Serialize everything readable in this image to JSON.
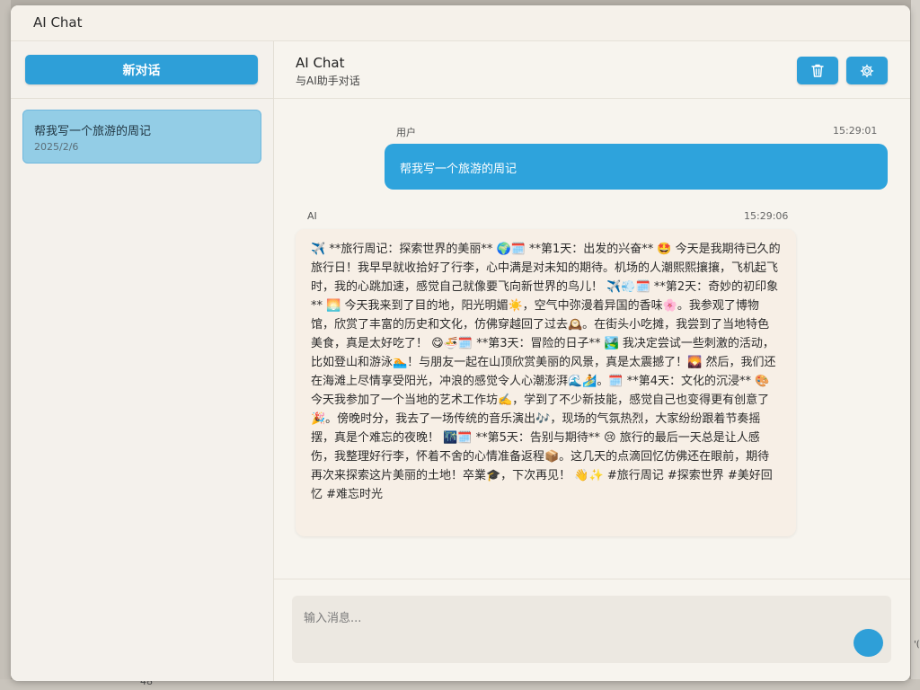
{
  "window": {
    "title": "AI Chat"
  },
  "sidebar": {
    "new_chat_label": "新对话",
    "conversations": [
      {
        "title": "帮我写一个旅游的周记",
        "date": "2025/2/6"
      }
    ]
  },
  "chat": {
    "title": "AI Chat",
    "subtitle": "与AI助手对话",
    "delete_icon": "trash-icon",
    "settings_icon": "gear-icon",
    "messages": [
      {
        "sender": "用户",
        "time": "15:29:01",
        "text": "帮我写一个旅游的周记"
      },
      {
        "sender": "AI",
        "time": "15:29:06",
        "text": "✈️ **旅行周记：探索世界的美丽** 🌍🗓️ **第1天：出发的兴奋** 🤩 今天是我期待已久的旅行日！我早早就收拾好了行李，心中满是对未知的期待。机场的人潮熙熙攘攘，飞机起飞时，我的心跳加速，感觉自己就像要飞向新世界的鸟儿！ ✈️💨🗓️ **第2天：奇妙的初印象** 🌅 今天我来到了目的地，阳光明媚☀️，空气中弥漫着异国的香味🌸。我参观了博物馆，欣赏了丰富的历史和文化，仿佛穿越回了过去🕰️。在街头小吃摊，我尝到了当地特色美食，真是太好吃了！ 😋🍜🗓️ **第3天：冒险的日子** 🏞️ 我决定尝试一些刺激的活动，比如登山和游泳🏊！与朋友一起在山顶欣赏美丽的风景，真是太震撼了！🌄 然后，我们还在海滩上尽情享受阳光，冲浪的感觉令人心潮澎湃🌊🏄。🗓️ **第4天：文化的沉浸** 🎨 今天我参加了一个当地的艺术工作坊✍️，学到了不少新技能，感觉自己也变得更有创意了🎉。傍晚时分，我去了一场传统的音乐演出🎶，现场的气氛热烈，大家纷纷跟着节奏摇摆，真是个难忘的夜晚！ 🌃🗓️ **第5天：告别与期待** 😢 旅行的最后一天总是让人感伤，我整理好行李，怀着不舍的心情准备返程📦。这几天的点滴回忆仿佛还在眼前，期待再次来探索这片美丽的土地！卒業🎓，下次再见！ 👋✨ #旅行周记 #探索世界 #美好回忆 #难忘时光"
      }
    ]
  },
  "input": {
    "placeholder": "输入消息...",
    "send_icon": "send-icon"
  },
  "background": {
    "page_number": "48"
  },
  "colors": {
    "accent": "#2e9fd8",
    "selected_item": "#93cde6",
    "ai_bubble": "#f7efe6"
  }
}
